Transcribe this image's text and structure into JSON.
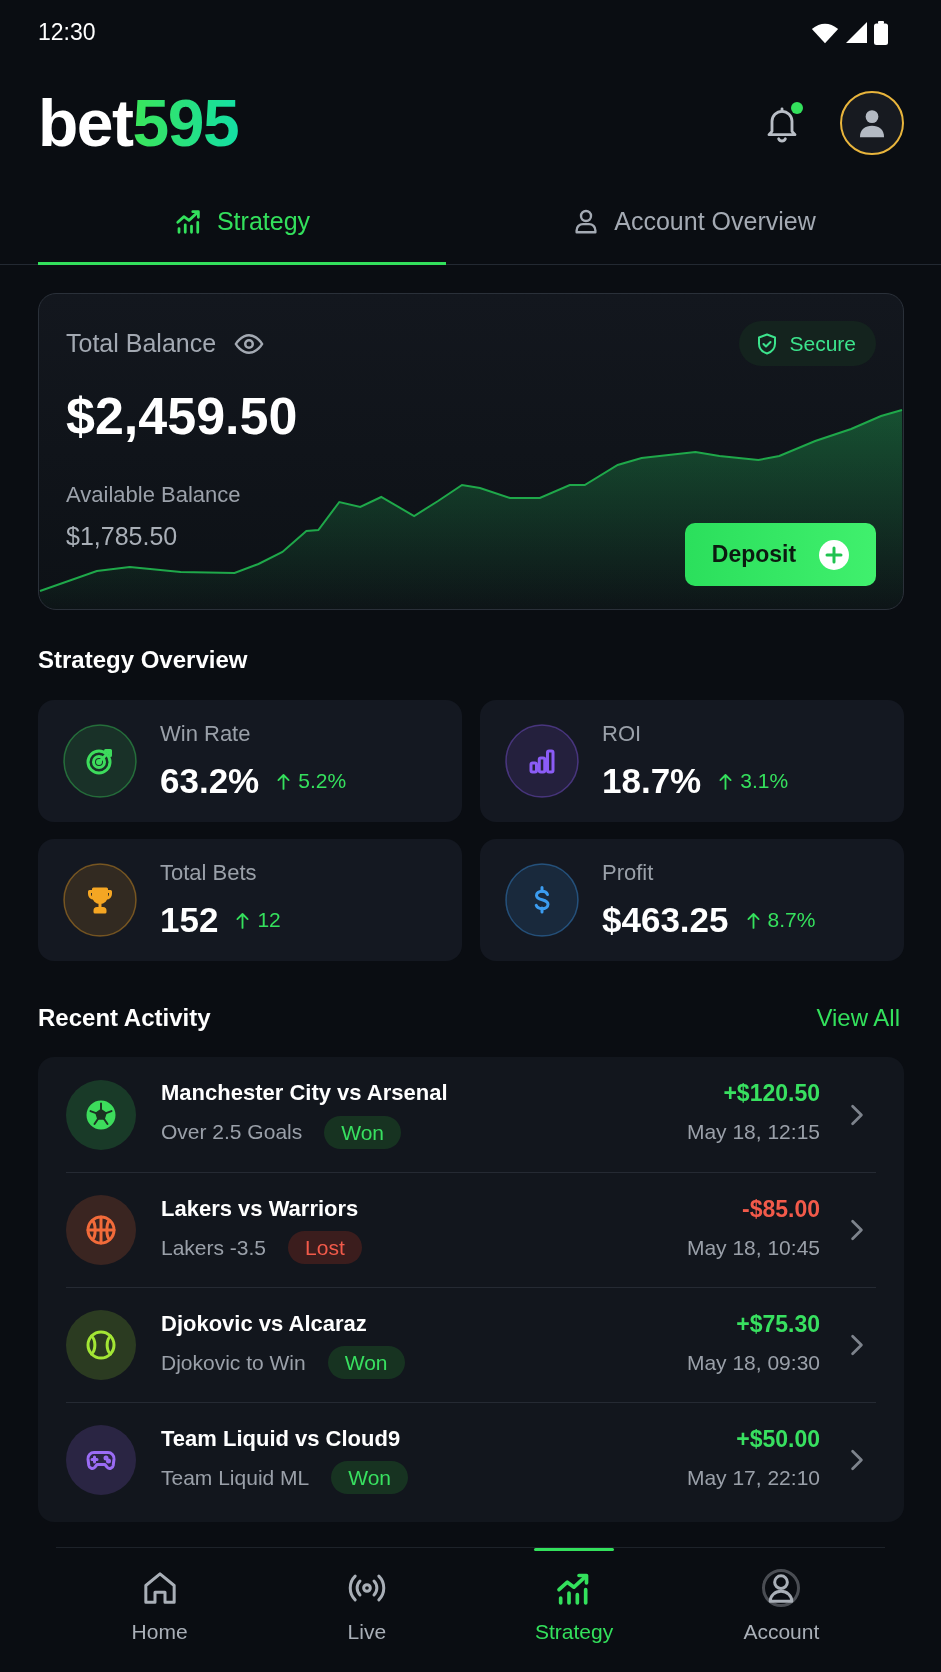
{
  "status_bar": {
    "time": "12:30"
  },
  "header": {
    "logo": {
      "text": "bet",
      "accent": "595"
    },
    "notifications": {
      "unread": true
    }
  },
  "tabs": [
    {
      "kind": "strategy",
      "label": "Strategy",
      "selected": true
    },
    {
      "kind": "account",
      "label": "Account Overview",
      "selected": false
    }
  ],
  "balance_card": {
    "title": "Total Balance",
    "badge": "Secure",
    "total": "$2,459.50",
    "available_label": "Available Balance",
    "available": "$1,785.50",
    "deposit_button": "Deposit"
  },
  "strategy_overview": {
    "title": "Strategy Overview",
    "stats": [
      {
        "kind": "winrate",
        "color": "#3ddc5c",
        "label": "Win Rate",
        "value": "63.2%",
        "rising": true,
        "change": "5.2%"
      },
      {
        "kind": "roi",
        "color": "#8b5cf6",
        "label": "ROI",
        "value": "18.7%",
        "rising": true,
        "change": "3.1%"
      },
      {
        "kind": "bets",
        "color": "#f5a623",
        "label": "Total Bets",
        "value": "152",
        "rising": true,
        "change": "12"
      },
      {
        "kind": "profit",
        "color": "#3b9cf0",
        "label": "Profit",
        "value": "$463.25",
        "rising": true,
        "change": "8.7%"
      }
    ]
  },
  "recent_activity": {
    "title": "Recent Activity",
    "view_all": "View All",
    "items": [
      {
        "kind": "soccer",
        "color": "#3ddc5c",
        "title": "Manchester City vs Arsenal",
        "market": "Over 2.5 Goals",
        "result": "Won",
        "won": true,
        "amount": "+$120.50",
        "time": "May 18, 12:15"
      },
      {
        "kind": "basketball",
        "color": "#f26b3a",
        "title": "Lakers vs Warriors",
        "market": "Lakers -3.5",
        "result": "Lost",
        "won": false,
        "amount": "-$85.00",
        "time": "May 18, 10:45"
      },
      {
        "kind": "tennis",
        "color": "#a3e635",
        "title": "Djokovic vs Alcaraz",
        "market": "Djokovic to Win",
        "result": "Won",
        "won": true,
        "amount": "+$75.30",
        "time": "May 18, 09:30"
      },
      {
        "kind": "esports",
        "color": "#9b6cf5",
        "title": "Team Liquid vs Cloud9",
        "market": "Team Liquid ML",
        "result": "Won",
        "won": true,
        "amount": "+$50.00",
        "time": "May 17, 22:10"
      }
    ]
  },
  "bottom_nav": [
    {
      "kind": "home",
      "label": "Home",
      "selected": false
    },
    {
      "kind": "live",
      "label": "Live",
      "selected": false
    },
    {
      "kind": "strategy",
      "label": "Strategy",
      "selected": true
    },
    {
      "kind": "account",
      "label": "Account",
      "selected": false
    }
  ]
}
